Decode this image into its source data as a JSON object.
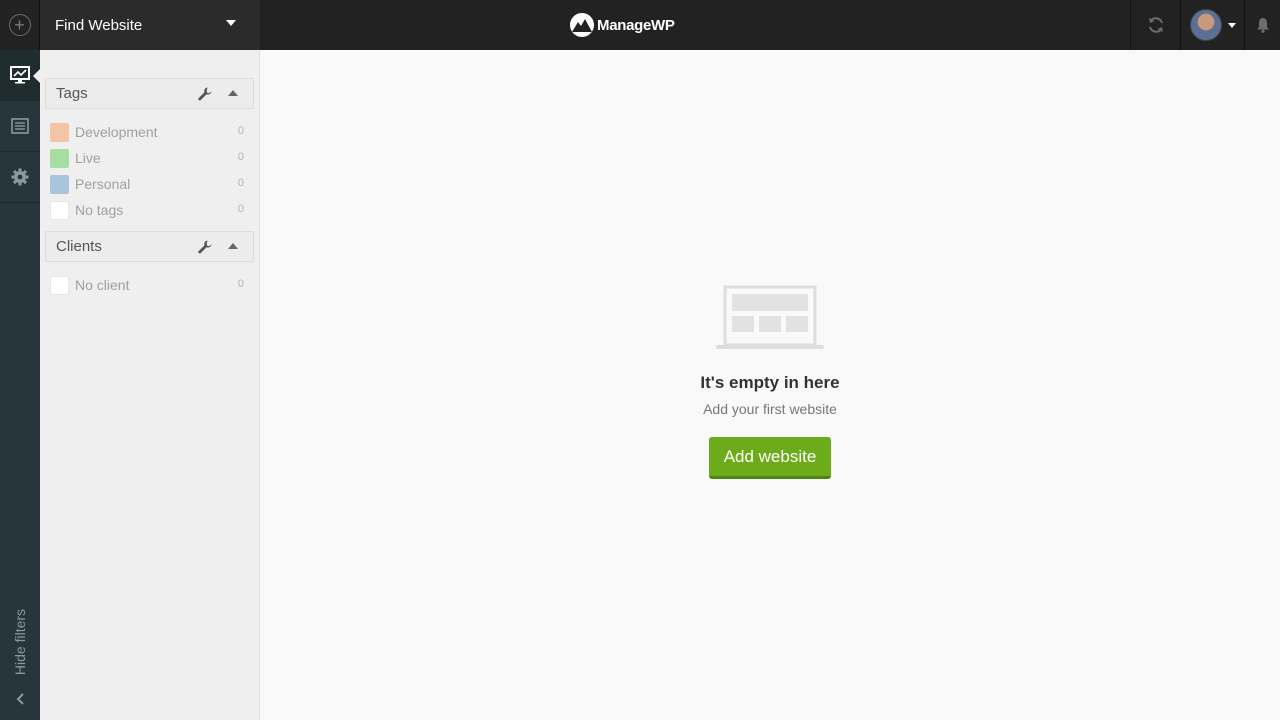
{
  "topbar": {
    "find_website_label": "Find Website",
    "logo_text": "ManageWP",
    "add_icon": "circle-plus-icon",
    "refresh_icon": "refresh-icon",
    "notifications_icon": "bell-icon"
  },
  "rail": {
    "items": [
      {
        "icon": "dashboard-monitor-icon",
        "active": true
      },
      {
        "icon": "list-icon",
        "active": false
      },
      {
        "icon": "gear-icon",
        "active": false
      }
    ],
    "hide_filters_label": "Hide filters"
  },
  "filters": {
    "tags": {
      "title": "Tags",
      "items": [
        {
          "label": "Development",
          "count": "0",
          "color": "#f2c5a4"
        },
        {
          "label": "Live",
          "count": "0",
          "color": "#a6dea2"
        },
        {
          "label": "Personal",
          "count": "0",
          "color": "#a9c4dd"
        },
        {
          "label": "No tags",
          "count": "0",
          "color": "#ffffff"
        }
      ]
    },
    "clients": {
      "title": "Clients",
      "items": [
        {
          "label": "No client",
          "count": "0",
          "color": "#ffffff"
        }
      ]
    }
  },
  "main": {
    "empty_title": "It's empty in here",
    "empty_subtitle": "Add your first website",
    "add_button_label": "Add website"
  },
  "colors": {
    "accent_green": "#6cab19",
    "topbar_bg": "#222222",
    "rail_bg": "#27363b"
  }
}
